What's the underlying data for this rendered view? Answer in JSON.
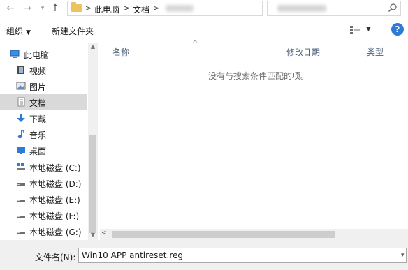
{
  "address": {
    "crumbs": [
      "此电脑",
      "文档"
    ],
    "separators": [
      ">",
      ">",
      ">"
    ]
  },
  "toolbar": {
    "organize_label": "组织",
    "new_folder_label": "新建文件夹"
  },
  "nav": {
    "items": [
      {
        "label": "此电脑",
        "icon": "computer-icon"
      },
      {
        "label": "视频",
        "icon": "video-icon"
      },
      {
        "label": "图片",
        "icon": "pictures-icon"
      },
      {
        "label": "文档",
        "icon": "documents-icon",
        "selected": true
      },
      {
        "label": "下载",
        "icon": "download-icon"
      },
      {
        "label": "音乐",
        "icon": "music-icon"
      },
      {
        "label": "桌面",
        "icon": "desktop-icon"
      },
      {
        "label": "本地磁盘 (C:)",
        "icon": "drive-c-icon"
      },
      {
        "label": "本地磁盘 (D:)",
        "icon": "drive-icon"
      },
      {
        "label": "本地磁盘 (E:)",
        "icon": "drive-icon"
      },
      {
        "label": "本地磁盘 (F:)",
        "icon": "drive-icon"
      },
      {
        "label": "本地磁盘 (G:)",
        "icon": "drive-icon"
      }
    ]
  },
  "columns": {
    "name": "名称",
    "modified": "修改日期",
    "type": "类型"
  },
  "content": {
    "empty_message": "没有与搜索条件匹配的项。"
  },
  "filename": {
    "label": "文件名(N):",
    "value": "Win10 APP antireset.reg"
  },
  "colors": {
    "selection": "#d9d9d9",
    "help_blue": "#2d7bd6",
    "header_text": "#4c607a",
    "folder_yellow": "#e9c45f"
  }
}
